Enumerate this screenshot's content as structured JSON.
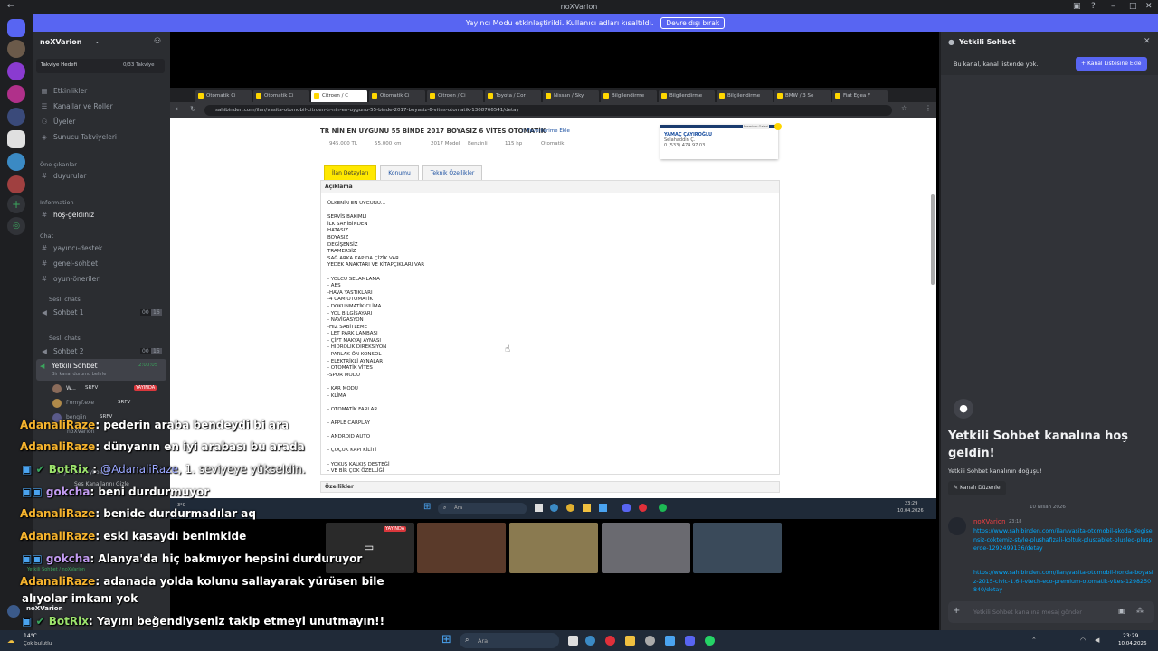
{
  "window": {
    "title": "noXVarion"
  },
  "banner": {
    "text": "Yayıncı Modu etkinleştirildi. Kullanıcı adları kısaltıldı.",
    "button": "Devre dışı bırak"
  },
  "server": {
    "name": "noXVarion",
    "boost_label": "Takviye Hedefi",
    "boost_progress": "0/33 Takviye"
  },
  "channels": {
    "top": [
      {
        "label": "Etkinlikler",
        "icon": "calendar-icon"
      },
      {
        "label": "Kanallar ve Roller",
        "icon": "list-icon"
      },
      {
        "label": "Üyeler",
        "icon": "members-icon"
      },
      {
        "label": "Sunucu Takviyeleri",
        "icon": "boost-icon"
      }
    ],
    "cat_featured": "Öne çıkanlar",
    "featured": [
      {
        "label": "duyurular"
      }
    ],
    "cat_info": "Information",
    "info": [
      {
        "label": "hoş-geldiniz"
      }
    ],
    "cat_chat": "Chat",
    "chat": [
      {
        "label": "yayıncı-destek"
      },
      {
        "label": "genel-sohbet"
      },
      {
        "label": "oyun-önerileri"
      }
    ],
    "cat_voice1": "Sesli chats",
    "voice1": {
      "label": "Sohbet 1",
      "count_a": "00",
      "count_b": "16"
    },
    "cat_voice2": "Sesli chats",
    "voice2": {
      "label": "Sohbet 2",
      "count_a": "00",
      "count_b": "15"
    },
    "active": {
      "label": "Yetkili Sohbet",
      "timer": "2:00:05",
      "status": "Bir kanal durumu belirle"
    },
    "voice_users": [
      {
        "name": "W...",
        "tag": "SRFV",
        "badge": "YAYINDA"
      },
      {
        "name": "f'omyf.exe",
        "tag": "SRFV"
      },
      {
        "name": "bengiin",
        "tag": "SRFV"
      }
    ],
    "user": {
      "name": "noXVarion",
      "status": "away from keyboard",
      "hide_voice": "Ses Kanallarını Gizle",
      "connected": "Yetkili Sohbet / noXVarion"
    }
  },
  "browser": {
    "tabs": [
      "Otomatik Ci",
      "Otomatik Ci",
      "Citroen / C",
      "Otomatik Ci",
      "Citroen / Ci",
      "Toyota / Cor",
      "Nissan / Sky",
      "Bilgilendirme",
      "Bilgilendirme",
      "Bilgilendirme",
      "BMW / 3 Se",
      "Fiat Egea F"
    ],
    "url": "sahibinden.com/ilan/vasita-otomobil-citroen-tr-nin-en-uygunu-55-binde-2017-boyasiz-6-vites-otomatik-1308766541/detay",
    "listing_title": "TR NİN EN UYGUNU 55 BİNDE 2017 BOYASIZ 6 VİTES OTOMATİK",
    "fav": "Favorilerime Ekle",
    "specs": [
      "945.000 TL",
      "55.000 km",
      "2017 Model",
      "Benzinli",
      "115 hp",
      "Otomatik"
    ],
    "seller": {
      "name": "YAMAÇ ÇAYIROĞLU",
      "rep": "Selahaddin Ç.",
      "phone": "0 (533) 474 97 03",
      "badge": "Premium Galeri"
    },
    "page_tabs": [
      "İlan Detayları",
      "Konumu",
      "Teknik Özellikler"
    ],
    "desc_head": "Açıklama",
    "desc": "ÜLKENİN EN UYGUNU...\n\nSERVİS BAKIMLI\nİLK SAHİBİNDEN\nHATASIZ\nBOYASIZ\nDEGİŞENSİZ\nTRAMERSİZ\nSAĞ ARKA KAPIDA ÇİZİK VAR\nYEDEK ANAKTARI VE KİTAPÇIKLARI VAR\n\n- YOLCU SELAMLAMA\n- ABS\n-HAVA YASTIKLARI\n-4 CAM OTOMATİK\n- DOKUNMATİK CLİMA\n- YOL BİLGİSAYARI\n- NAVİGASYON\n-HIZ SABİTLEME\n- LET PARK LAMBASI\n- ÇİFT MAKYAJ AYNASI\n- HİDROLİK DİREKSİYON\n- PARLAK ÖN KONSOL\n- ELEKTRİKLİ AYNALAR\n- OTOMATİK VİTES\n-SPOR MODU\n\n- KAR MODU\n- KLİMA\n\n- OTOMATİK FARLAR\n\n- APPLE CARPLAY\n\n- ANDROID AUTO\n\n- ÇOÇUK KAPI KİLİTİ\n\n- YOKUŞ KALKIŞ DESTEĞİ\n- VE BİR ÇOK ÖZELLİĞİ",
    "oz_head": "Özellikler",
    "search": "Ara",
    "clock": "23:29",
    "date": "10.04.2026",
    "temp": "3°C"
  },
  "stream_badge": "YAYINDA",
  "right": {
    "title": "Yetkili Sohbet",
    "not_listed": "Bu kanal, kanal listende yok.",
    "add_btn": "Kanal Listesine Ekle",
    "welcome_title": "Yetkili Sohbet kanalına hoş geldin!",
    "welcome_sub": "Yetkili Sohbet kanalının doğuşu!",
    "edit_btn": "Kanalı Düzenle",
    "date_divider": "10 Nisan 2026",
    "msg_author": "noXVarion",
    "msg_time": "23:18",
    "link1": "https://www.sahibinden.com/ilan/vasita-otomobil-skoda-degisensiz-coktemiz-style-plushafizali-koltuk-plustablet-plusled-plusperde-1292499136/detay",
    "link2": "https://www.sahibinden.com/ilan/vasita-otomobil-honda-boyasiz-2015-civic-1.6-i-vtech-eco-premium-otomatik-vites-1298250840/detay",
    "input_ph": "Yetkili Sohbet kanalına mesaj gönder"
  },
  "chat": [
    {
      "user": "AdanaliRaze",
      "text": ": pederin araba bendeydi bi ara"
    },
    {
      "user": "AdanaliRaze",
      "text": ": dünyanın en iyi arabası bu arada"
    },
    {
      "user": "BotRix",
      "mention": "@AdanaliRaze",
      "text": ", 1. seviyeye yükseldin."
    },
    {
      "user": "gokcha",
      "text": ": beni durdurmuyor"
    },
    {
      "user": "AdanaliRaze",
      "text": ": benide durdurmadılar aq"
    },
    {
      "user": "AdanaliRaze",
      "text": ": eski kasaydı benimkide"
    },
    {
      "user": "gokcha",
      "text": ": Alanya'da hiç bakmıyor hepsini durduruyor"
    },
    {
      "user": "AdanaliRaze",
      "text": ": adanada yolda kolunu sallayarak yürüsen bile"
    },
    {
      "text": "alıyolar imkanı yok"
    },
    {
      "user": "BotRix",
      "text": ": Yayını beğendiyseniz takip etmeyi unutmayın!!"
    }
  ],
  "taskbar": {
    "weather": "14°C",
    "weather_desc": "Çok bulutlu",
    "search": "Ara",
    "time": "23:29",
    "date": "10.04.2026"
  }
}
